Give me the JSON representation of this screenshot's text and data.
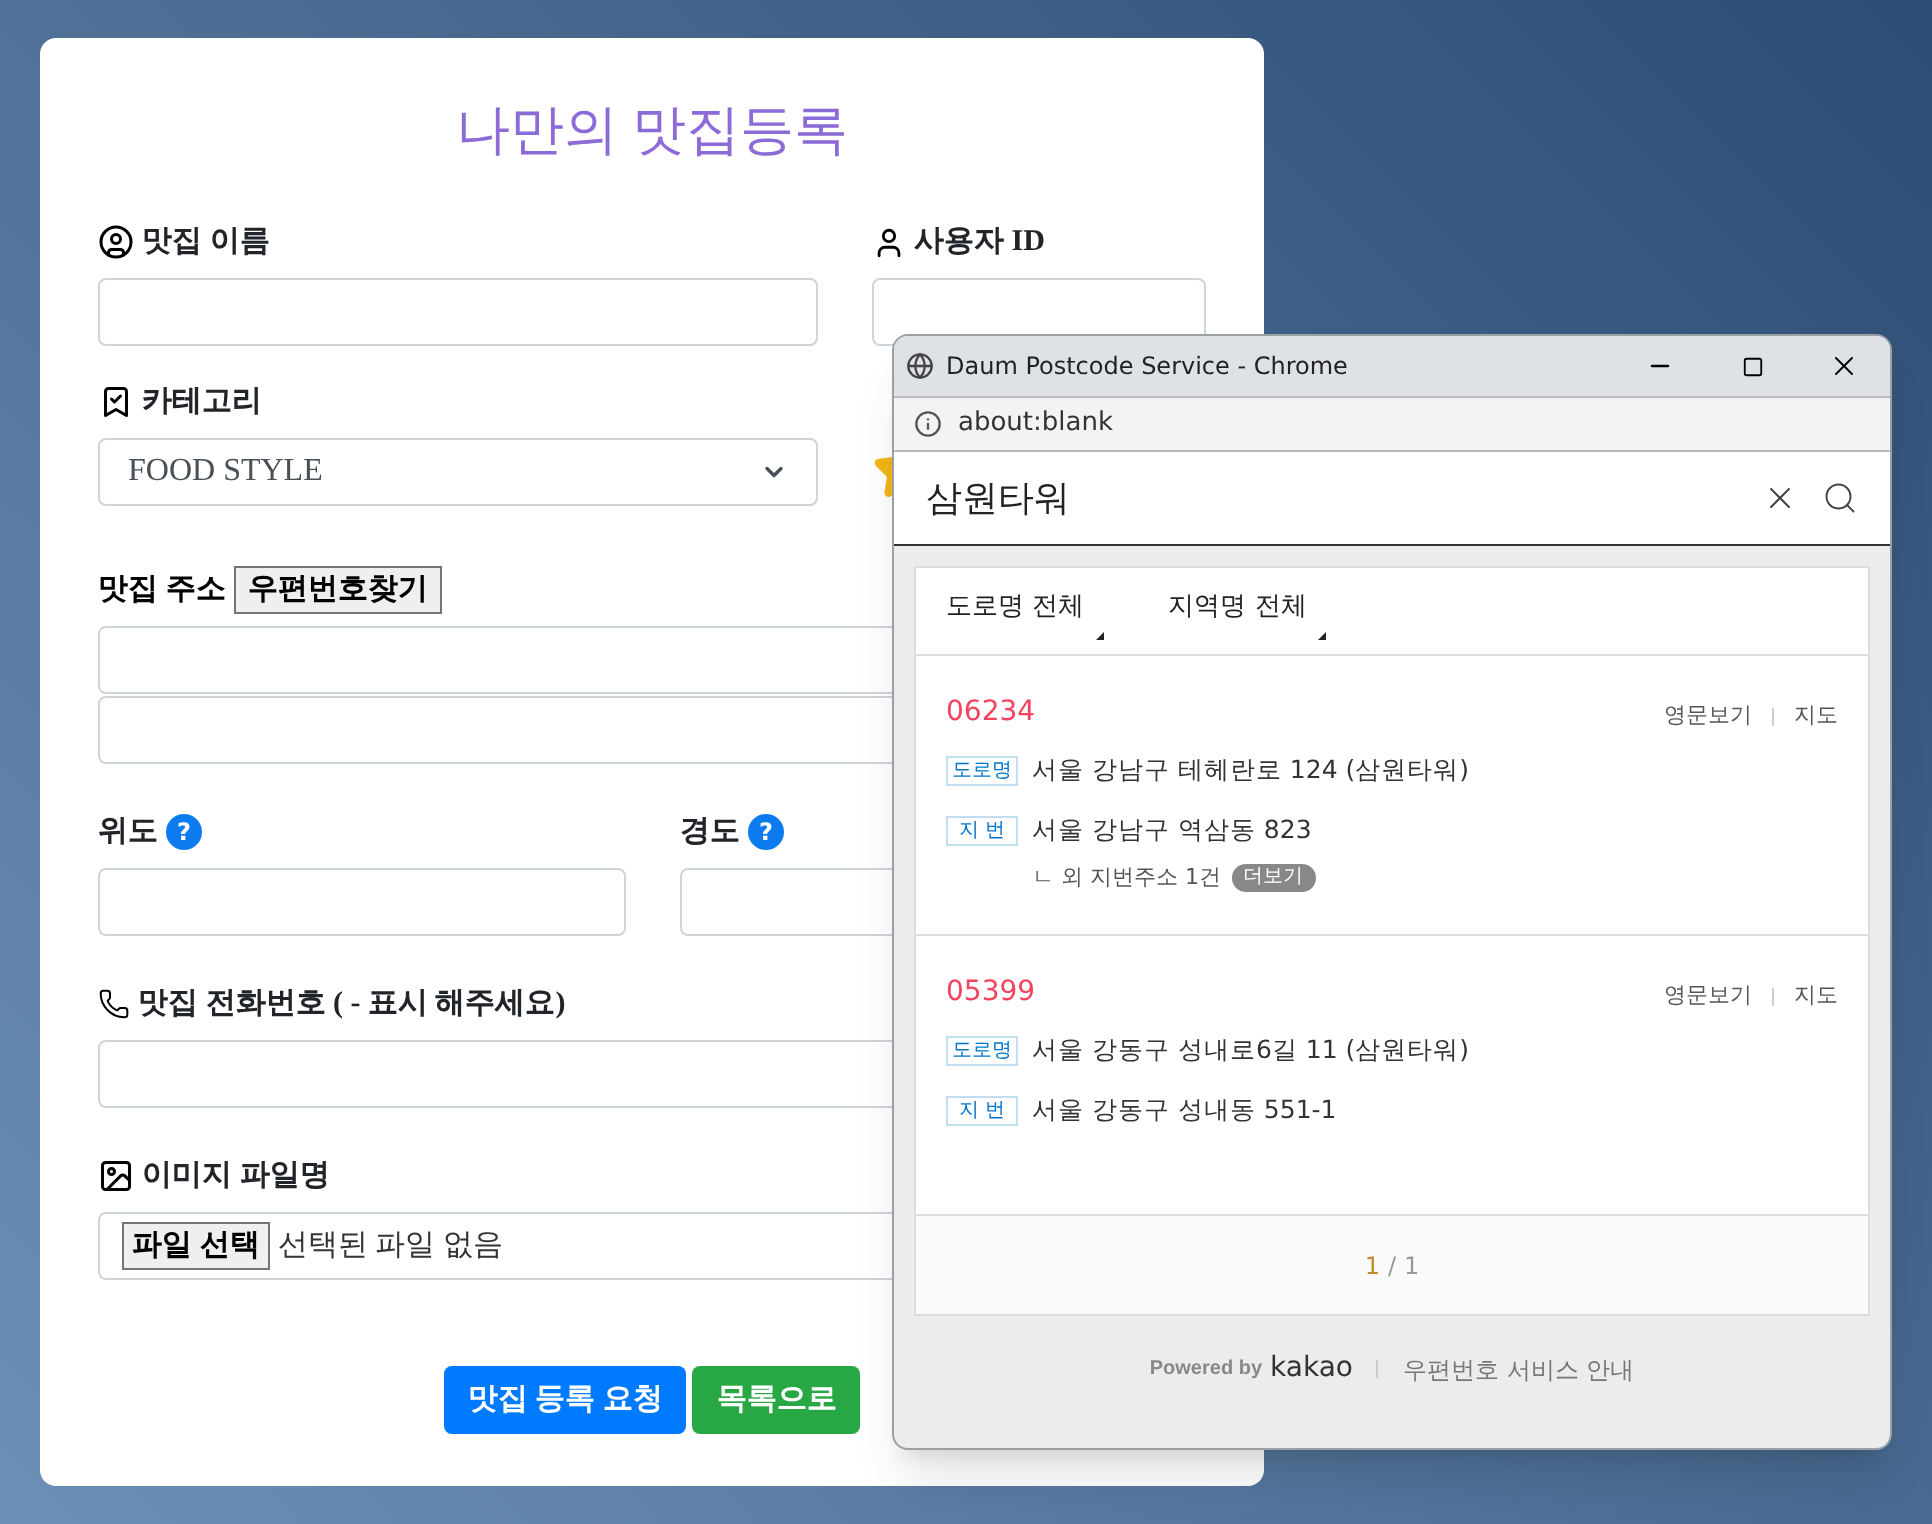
{
  "form": {
    "title": "나만의 맛집등록",
    "name_label": "맛집 이름",
    "user_label": "사용자 ID",
    "category_label": "카테고리",
    "category_value": "FOOD STYLE",
    "address_label": "맛집 주소",
    "postcode_button": "우편번호찾기",
    "lat_label": "위도",
    "lon_label": "경도",
    "help_mark": "?",
    "phone_label": "맛집 전화번호 ( - 표시 해주세요)",
    "image_label": "이미지 파일명",
    "file_button": "파일 선택",
    "file_status": "선택된 파일 없음",
    "buttons": [
      {
        "label": "맛집 등록 요청",
        "kind": "primary"
      },
      {
        "label": "목록으로",
        "kind": "success"
      }
    ]
  },
  "popup": {
    "title": "Daum Postcode Service - Chrome",
    "url": "about:blank",
    "query": "삼원타워",
    "filters": [
      {
        "label": "도로명 전체"
      },
      {
        "label": "지역명 전체"
      }
    ],
    "results": [
      {
        "zip": "06234",
        "english": "영문보기",
        "map": "지도",
        "lines": [
          {
            "tag": "도로명",
            "text": "서울 강남구 테헤란로 124 (삼원타워)"
          },
          {
            "tag": "지 번",
            "text": "서울 강남구 역삼동 823"
          }
        ],
        "extra": "ㄴ 외 지번주소 1건",
        "more": "더보기"
      },
      {
        "zip": "05399",
        "english": "영문보기",
        "map": "지도",
        "lines": [
          {
            "tag": "도로명",
            "text": "서울 강동구 성내로6길 11 (삼원타워)"
          },
          {
            "tag": "지 번",
            "text": "서울 강동구 성내동 551-1"
          }
        ]
      }
    ],
    "page_current": "1",
    "page_sep": "/",
    "page_total": "1",
    "powered": "Powered by",
    "brand": "kakao",
    "guide": "우편번호 서비스 안내"
  }
}
